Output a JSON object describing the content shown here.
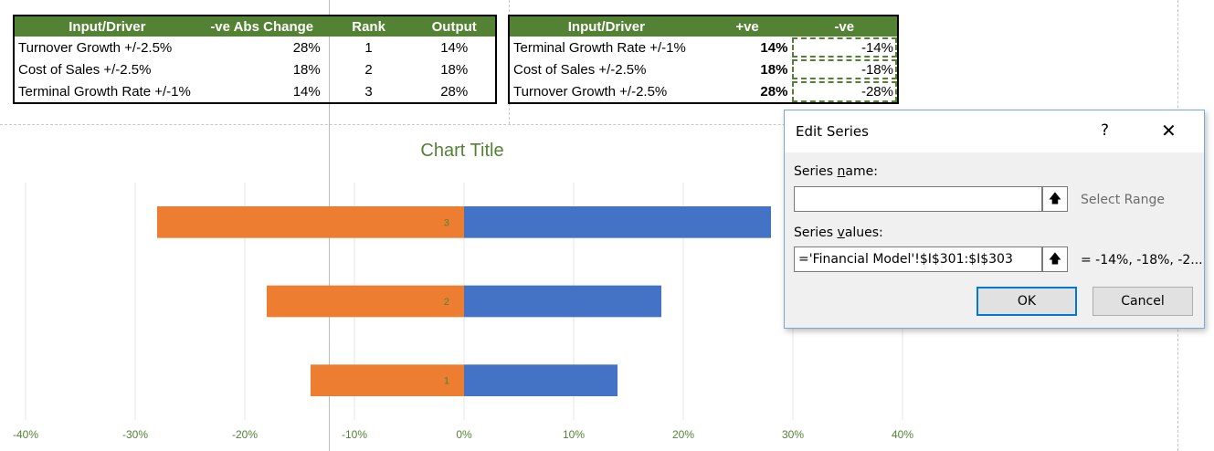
{
  "left_table": {
    "headers": [
      "Input/Driver",
      "-ve Abs Change",
      "Rank",
      "Output"
    ],
    "rows": [
      [
        "Turnover Growth +/-2.5%",
        "28%",
        "1",
        "14%"
      ],
      [
        "Cost of Sales +/-2.5%",
        "18%",
        "2",
        "18%"
      ],
      [
        "Terminal Growth Rate +/-1%",
        "14%",
        "3",
        "28%"
      ]
    ]
  },
  "right_table": {
    "headers": [
      "Input/Driver",
      "+ve",
      "-ve"
    ],
    "rows": [
      [
        "Terminal Growth Rate +/-1%",
        "14%",
        "-14%"
      ],
      [
        "Cost of Sales +/-2.5%",
        "18%",
        "-18%"
      ],
      [
        "Turnover Growth +/-2.5%",
        "28%",
        "-28%"
      ]
    ]
  },
  "chart_data": {
    "type": "bar",
    "orientation": "horizontal",
    "title": "Chart Title",
    "categories": [
      "1",
      "2",
      "3"
    ],
    "series": [
      {
        "values": [
          14,
          18,
          28
        ],
        "color": "#4472c4"
      },
      {
        "values": [
          -14,
          -18,
          -28
        ],
        "color": "#ed7d31"
      }
    ],
    "xlim": [
      -40,
      40
    ],
    "x_ticks": [
      "-40%",
      "-30%",
      "-20%",
      "-10%",
      "0%",
      "10%",
      "20%",
      "30%",
      "40%"
    ],
    "grid": true,
    "legend": "none"
  },
  "dialog": {
    "title": "Edit Series",
    "help": "?",
    "close": "✕",
    "series_name_label": "Series name:",
    "series_name_value": "",
    "select_range_text": "Select Range",
    "series_values_label": "Series values:",
    "series_values_value": "='Financial Model'!$I$301:$I$303",
    "series_values_preview": "= -14%, -18%, -2...",
    "range_button_icon": "collapse-range-icon",
    "ok_label": "OK",
    "cancel_label": "Cancel"
  },
  "colors": {
    "header_green": "#548235",
    "axis_green": "#548235",
    "bar_blue": "#4472c4",
    "bar_orange": "#ed7d31"
  }
}
